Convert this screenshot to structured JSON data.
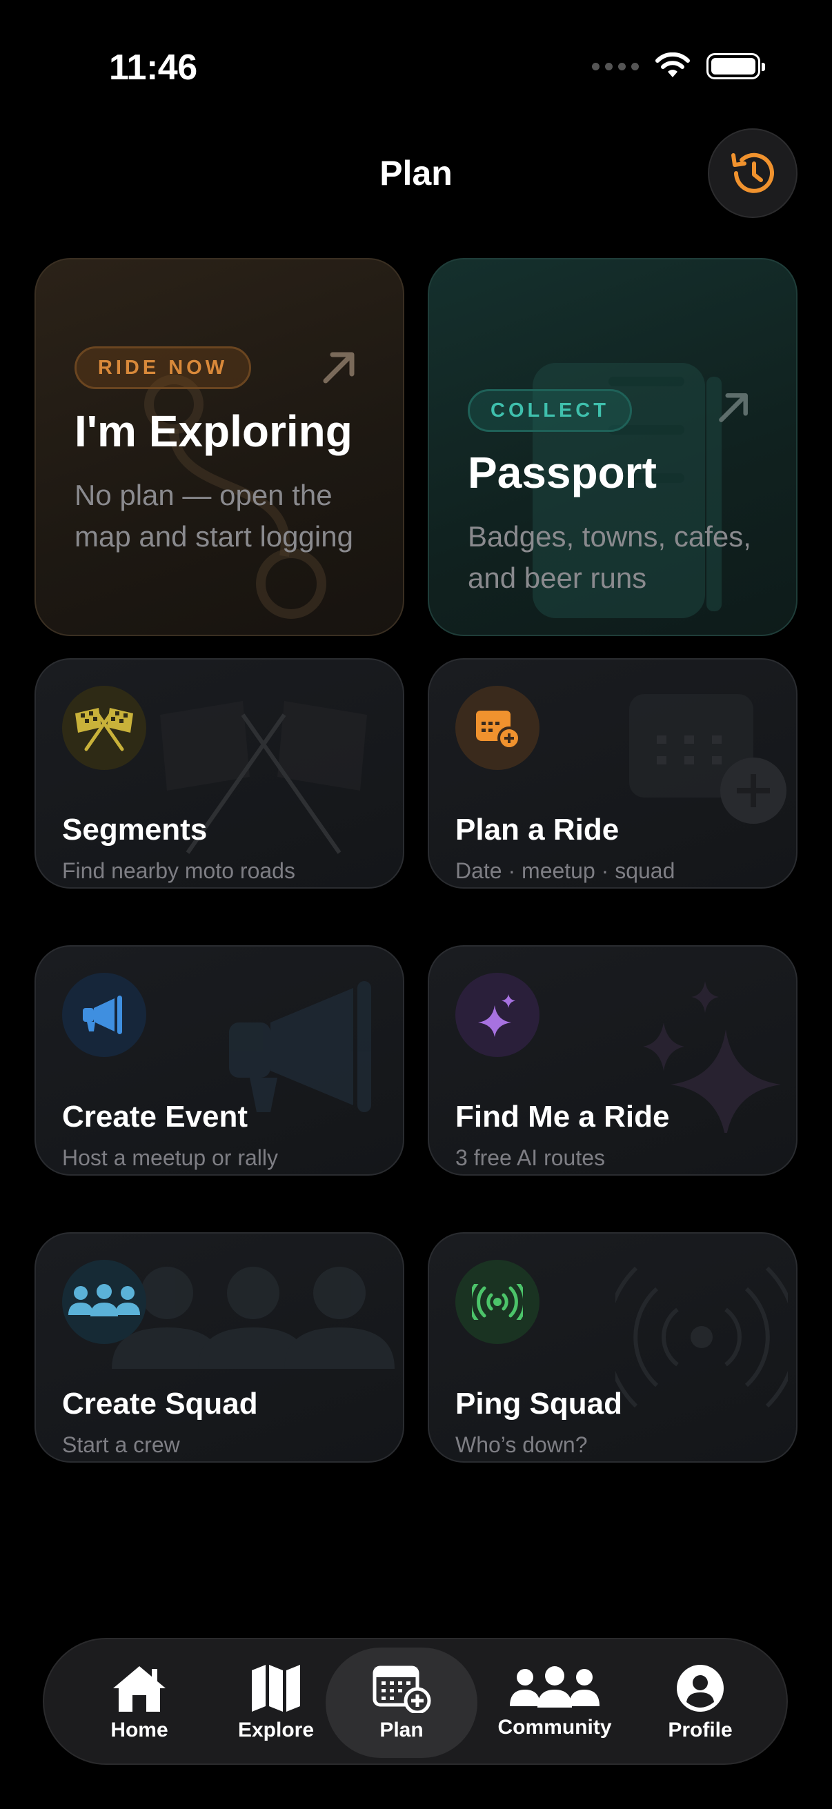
{
  "status_bar": {
    "time": "11:46"
  },
  "header": {
    "title": "Plan"
  },
  "cards": {
    "exploring": {
      "badge": "RIDE NOW",
      "title": "I'm Exploring",
      "subtitle": "No plan — open the map and start logging"
    },
    "passport": {
      "badge": "COLLECT",
      "title": "Passport",
      "subtitle": "Badges, towns, cafes, and beer runs"
    },
    "segments": {
      "title": "Segments",
      "subtitle": "Find nearby moto roads"
    },
    "plan_ride": {
      "title": "Plan a Ride",
      "subtitle": "Date · meetup · squad"
    },
    "create_event": {
      "title": "Create Event",
      "subtitle": "Host a meetup or rally"
    },
    "find_ride": {
      "title": "Find Me a Ride",
      "subtitle": "3 free AI routes"
    },
    "create_squad": {
      "title": "Create Squad",
      "subtitle": "Start a crew"
    },
    "ping_squad": {
      "title": "Ping Squad",
      "subtitle": "Who’s down?"
    }
  },
  "tabbar": {
    "items": [
      {
        "label": "Home",
        "icon": "house-icon"
      },
      {
        "label": "Explore",
        "icon": "map-icon"
      },
      {
        "label": "Plan",
        "icon": "calendar-plus-icon",
        "active": true
      },
      {
        "label": "Community",
        "icon": "people-icon"
      },
      {
        "label": "Profile",
        "icon": "person-circle-icon"
      }
    ]
  },
  "colors": {
    "accent_orange": "#f0922e",
    "accent_teal": "#3fc0ad",
    "segments_icon": "#c9b23a",
    "event_icon": "#3f8fe0",
    "find_icon": "#a772e0",
    "squad_icon": "#5bb2d8",
    "ping_icon": "#4cc46a"
  }
}
